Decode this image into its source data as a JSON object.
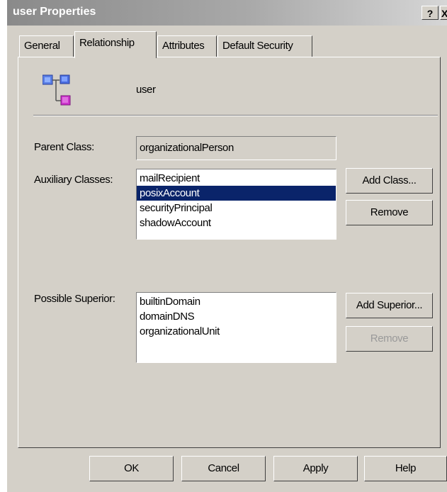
{
  "window": {
    "title": "user Properties",
    "help_glyph": "?",
    "close_glyph": "X"
  },
  "tabs": [
    {
      "label": "General",
      "active": false
    },
    {
      "label": "Relationship",
      "active": true
    },
    {
      "label": "Attributes",
      "active": false
    },
    {
      "label": "Default Security",
      "active": false
    }
  ],
  "header": {
    "icon": "class-hierarchy-icon",
    "name": "user"
  },
  "parent_class": {
    "label": "Parent Class:",
    "value": "organizationalPerson"
  },
  "auxiliary_classes": {
    "label": "Auxiliary Classes:",
    "items": [
      "mailRecipient",
      "posixAccount",
      "securityPrincipal",
      "shadowAccount"
    ],
    "selected": "posixAccount",
    "add_button": "Add Class...",
    "remove_button": "Remove"
  },
  "possible_superior": {
    "label": "Possible Superior:",
    "items": [
      "builtinDomain",
      "domainDNS",
      "organizationalUnit"
    ],
    "add_button": "Add Superior...",
    "remove_button": "Remove",
    "remove_enabled": false
  },
  "footer": {
    "ok": "OK",
    "cancel": "Cancel",
    "apply": "Apply",
    "help": "Help"
  },
  "colors": {
    "dialog_face": "#d4d0c8",
    "selection": "#0a246a"
  }
}
